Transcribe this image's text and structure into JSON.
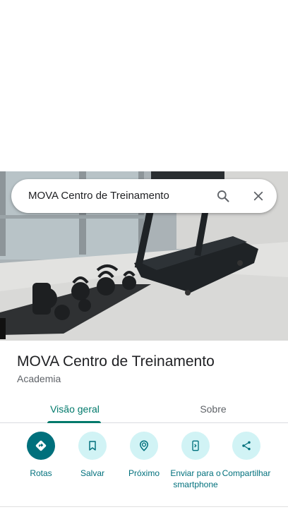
{
  "search": {
    "query": "MOVA Centro de Treinamento"
  },
  "place": {
    "title": "MOVA Centro de Treinamento",
    "category": "Academia"
  },
  "tabs": [
    {
      "label": "Visão geral",
      "active": true
    },
    {
      "label": "Sobre",
      "active": false
    }
  ],
  "actions": [
    {
      "label": "Rotas",
      "icon": "directions-icon"
    },
    {
      "label": "Salvar",
      "icon": "bookmark-icon"
    },
    {
      "label": "Próximo",
      "icon": "nearby-icon"
    },
    {
      "label": "Enviar para o smartphone",
      "icon": "send-to-phone-icon"
    },
    {
      "label": "Compartilhar",
      "icon": "share-icon"
    }
  ],
  "colors": {
    "accent": "#00707c",
    "tab_active": "#00796b",
    "action_bg": "#d1f3f5"
  }
}
